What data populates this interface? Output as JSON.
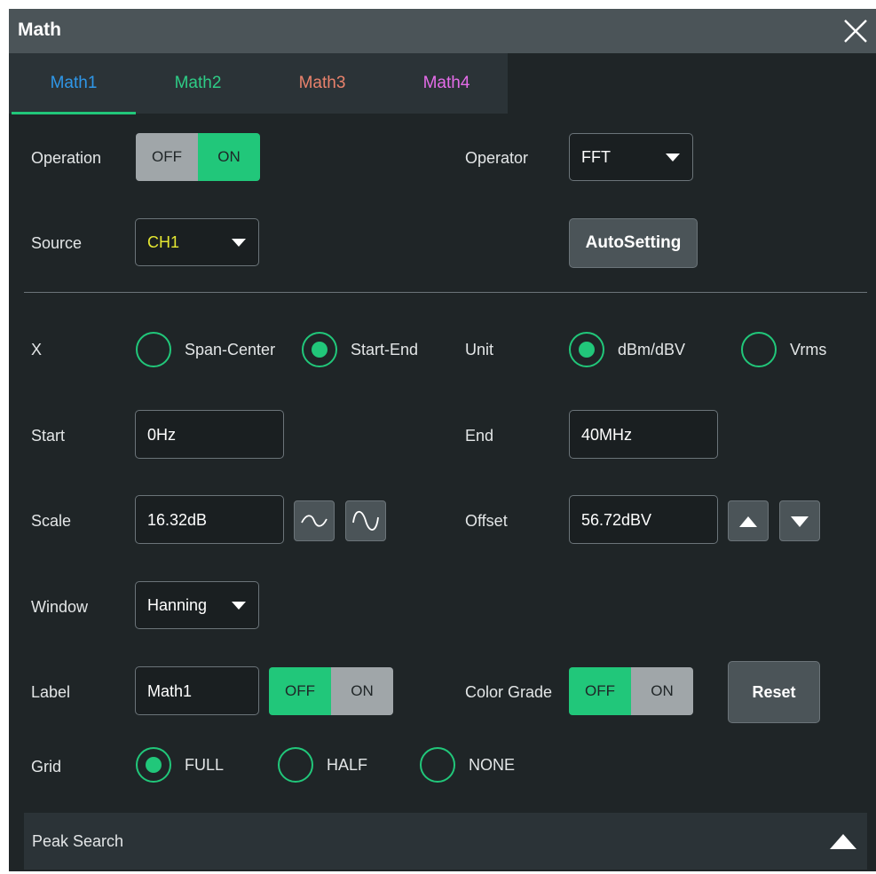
{
  "dialog": {
    "title": "Math"
  },
  "tabs": [
    {
      "label": "Math1",
      "color": "#2f97e8",
      "selected": true
    },
    {
      "label": "Math2",
      "color": "#2ecc86"
    },
    {
      "label": "Math3",
      "color": "#e9826c"
    },
    {
      "label": "Math4",
      "color": "#e46ce8"
    }
  ],
  "operation": {
    "label": "Operation",
    "off": "OFF",
    "on": "ON",
    "state": "ON"
  },
  "operator": {
    "label": "Operator",
    "value": "FFT"
  },
  "source": {
    "label": "Source",
    "value": "CH1",
    "value_color": "#e6e832"
  },
  "autosetting": {
    "label": "AutoSetting"
  },
  "x_mode": {
    "label": "X",
    "options": [
      "Span-Center",
      "Start-End"
    ],
    "selected": "Start-End"
  },
  "unit": {
    "label": "Unit",
    "options": [
      "dBm/dBV",
      "Vrms"
    ],
    "selected": "dBm/dBV"
  },
  "start": {
    "label": "Start",
    "value": "0Hz"
  },
  "end": {
    "label": "End",
    "value": "40MHz"
  },
  "scale": {
    "label": "Scale",
    "value": "16.32dB"
  },
  "offset": {
    "label": "Offset",
    "value": "56.72dBV"
  },
  "window": {
    "label": "Window",
    "value": "Hanning"
  },
  "label": {
    "label": "Label",
    "value": "Math1",
    "off": "OFF",
    "on": "ON",
    "state": "OFF"
  },
  "color_grade": {
    "label": "Color Grade",
    "off": "OFF",
    "on": "ON",
    "state": "OFF"
  },
  "reset": {
    "label": "Reset"
  },
  "grid": {
    "label": "Grid",
    "options": [
      "FULL",
      "HALF",
      "NONE"
    ],
    "selected": "FULL"
  },
  "peak_search": {
    "label": "Peak Search"
  },
  "colors": {
    "accent": "#21c77a",
    "panel": "#1f2527",
    "titlebar": "#4b5458"
  }
}
